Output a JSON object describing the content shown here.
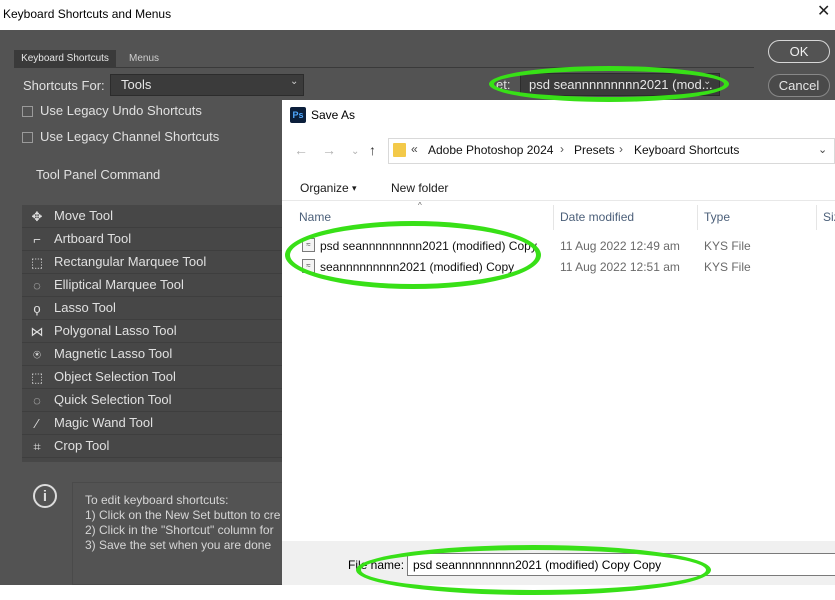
{
  "ps_window": {
    "title": "Keyboard Shortcuts and Menus",
    "close_glyph": "✕",
    "tabs": [
      {
        "label": "Keyboard Shortcuts",
        "active": true
      },
      {
        "label": "Menus",
        "active": false
      }
    ],
    "shortcuts_for_label": "Shortcuts For:",
    "shortcuts_for_value": "Tools",
    "set_label": "et:",
    "set_value": "psd seannnnnnnnn2021 (mod...",
    "chevron_glyph": "⌄",
    "ok_label": "OK",
    "cancel_label": "Cancel",
    "options": [
      {
        "label": "Use Legacy Undo Shortcuts",
        "checked": false
      },
      {
        "label": "Use Legacy Channel Shortcuts",
        "checked": false
      }
    ],
    "column_header": "Tool Panel Command",
    "tools": [
      {
        "label": "Move Tool",
        "icon": "move-icon",
        "glyph": "✥"
      },
      {
        "label": "Artboard Tool",
        "icon": "artboard-icon",
        "glyph": "⌐"
      },
      {
        "label": "Rectangular Marquee Tool",
        "icon": "rect-marquee-icon",
        "glyph": "⬚"
      },
      {
        "label": "Elliptical Marquee Tool",
        "icon": "ellipse-marquee-icon",
        "glyph": "◌"
      },
      {
        "label": "Lasso Tool",
        "icon": "lasso-icon",
        "glyph": "ϙ"
      },
      {
        "label": "Polygonal Lasso Tool",
        "icon": "polygonal-lasso-icon",
        "glyph": "⋈"
      },
      {
        "label": "Magnetic Lasso Tool",
        "icon": "magnetic-lasso-icon",
        "glyph": "⍟"
      },
      {
        "label": "Object Selection Tool",
        "icon": "object-selection-icon",
        "glyph": "⬚"
      },
      {
        "label": "Quick Selection Tool",
        "icon": "quick-selection-icon",
        "glyph": "◌"
      },
      {
        "label": "Magic Wand Tool",
        "icon": "magic-wand-icon",
        "glyph": "⁄"
      },
      {
        "label": "Crop Tool",
        "icon": "crop-icon",
        "glyph": "⌗"
      }
    ],
    "info_icon_glyph": "i",
    "info_lines": [
      "To edit keyboard shortcuts:",
      "1) Click on the New Set button to cre",
      "2) Click in the \"Shortcut\" column for",
      "3) Save the set when you are done"
    ]
  },
  "save_as": {
    "title": "Save As",
    "app_icon_text": "Ps",
    "nav": {
      "back": "←",
      "forward": "→",
      "recent": "⌄",
      "up": "↑"
    },
    "address": {
      "overflow": "«",
      "crumbs": [
        "Adobe Photoshop 2024",
        "Presets",
        "Keyboard Shortcuts"
      ],
      "separator": "›",
      "dropdown": "⌄"
    },
    "toolbar": {
      "organize": "Organize",
      "organize_chevron": "▾",
      "new_folder": "New folder"
    },
    "columns": {
      "name": "Name",
      "date": "Date modified",
      "type": "Type",
      "size": "Siz",
      "sort_glyph": "^"
    },
    "files": [
      {
        "name": "psd seannnnnnnnn2021 (modified) Copy",
        "date": "11 Aug 2022 12:49 am",
        "type": "KYS File"
      },
      {
        "name": "seannnnnnnnn2021 (modified) Copy",
        "date": "11 Aug 2022 12:51 am",
        "type": "KYS File"
      }
    ],
    "file_icon_glyph": "≈",
    "filename_label": "File name:",
    "filename_value": "psd seannnnnnnnn2021 (modified) Copy Copy"
  },
  "colors": {
    "annotation_green": "#38e017",
    "ps_panel": "#535353",
    "ps_list": "#474747",
    "folder_yellow": "#f3c949"
  }
}
